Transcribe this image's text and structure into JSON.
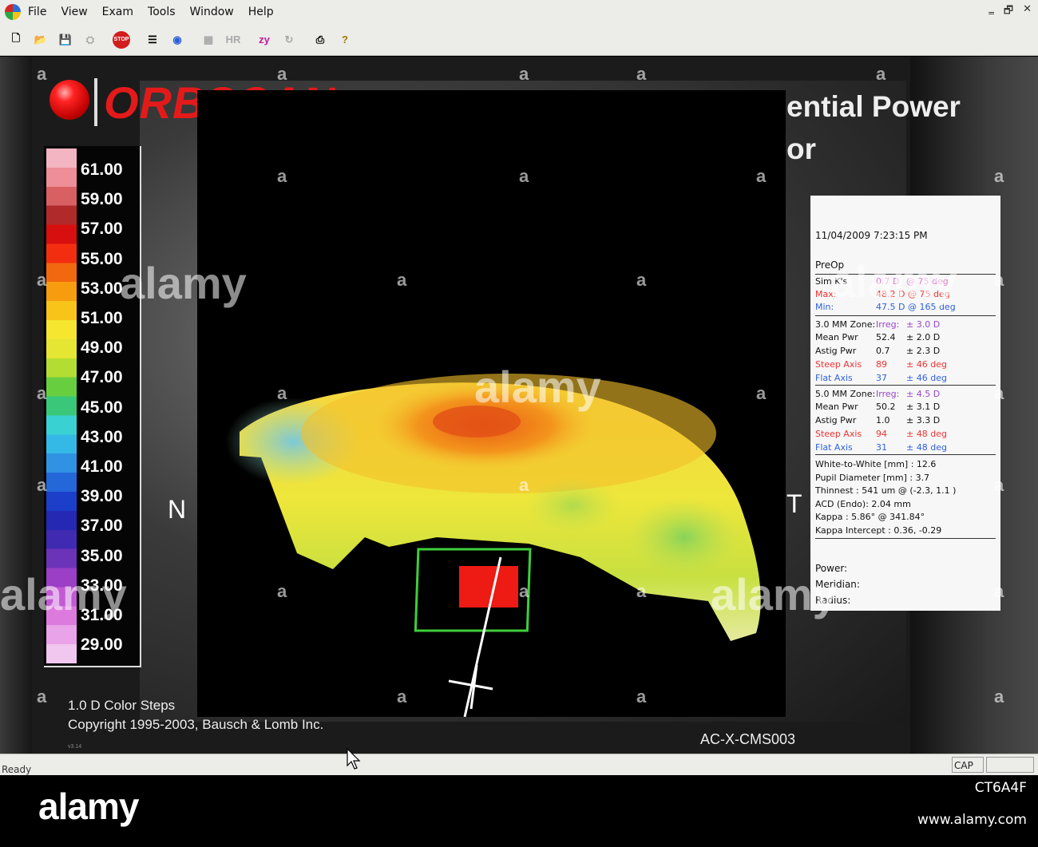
{
  "menu": {
    "items": [
      "File",
      "View",
      "Exam",
      "Tools",
      "Window",
      "Help"
    ],
    "window_controls": [
      "‗",
      "🗗",
      "✕"
    ]
  },
  "toolbar": {
    "buttons": [
      {
        "icon": "new-file-icon",
        "glyph": "🗋"
      },
      {
        "icon": "open-folder-icon",
        "glyph": "📂"
      },
      {
        "icon": "save-icon",
        "glyph": "💾"
      },
      {
        "icon": "disk-icon",
        "glyph": "⛭"
      },
      {
        "icon": "stop-icon",
        "label": "STOP"
      },
      {
        "icon": "list-icon",
        "glyph": "☰"
      },
      {
        "icon": "eye-icon",
        "glyph": "◉"
      },
      {
        "icon": "panel-icon",
        "glyph": "▦"
      },
      {
        "icon": "hr-icon",
        "label": "HR"
      },
      {
        "icon": "zy-icon",
        "label": "zy"
      },
      {
        "icon": "refresh-icon",
        "glyph": "↻"
      },
      {
        "icon": "print-icon",
        "glyph": "⎙"
      },
      {
        "icon": "help-icon",
        "glyph": "?"
      }
    ]
  },
  "header": {
    "logo_text": "ORBSCAN",
    "title_line1": "ential Power",
    "title_line2": "or"
  },
  "scale": {
    "labels": [
      "61.00",
      "59.00",
      "57.00",
      "55.00",
      "53.00",
      "51.00",
      "49.00",
      "47.00",
      "45.00",
      "43.00",
      "41.00",
      "39.00",
      "37.00",
      "35.00",
      "33.00",
      "31.00",
      "29.00"
    ],
    "colors": [
      "#f3b5c2",
      "#ee8e98",
      "#d86062",
      "#b02a2a",
      "#d80f0f",
      "#f32e10",
      "#f2680e",
      "#f89c0f",
      "#f8c419",
      "#f6e630",
      "#e5e533",
      "#b4dd33",
      "#67cf3f",
      "#39c77a",
      "#3ad1d3",
      "#34b9e6",
      "#2f92e3",
      "#2467d8",
      "#1b3fc9",
      "#2528b3",
      "#3f2ab1",
      "#6b33b8",
      "#9a3fc6",
      "#c35ad4",
      "#dc7bdd",
      "#e9a3e8",
      "#f1c6ef"
    ],
    "steps_label": "1.0 D Color Steps"
  },
  "footer_text": {
    "copyright": "Copyright 1995-2003, Bausch & Lomb Inc.",
    "version": "v3.14",
    "device_id": "AC-X-CMS003"
  },
  "map": {
    "side_left": "N",
    "side_right": "T"
  },
  "info": {
    "datetime": "11/04/2009 7:23:15 PM",
    "preop": "PreOp",
    "simk": {
      "label": "Sim K's",
      "a": "0.7 D",
      "b": "@ 75 deg"
    },
    "max": {
      "label": "Max:",
      "a": "48.2 D @ 75 deg"
    },
    "min": {
      "label": "Min:",
      "a": "47.5 D @ 165 deg"
    },
    "zone3": {
      "title": "3.0 MM Zone:",
      "irreg_label": "Irreg:",
      "irreg": "± 3.0 D",
      "rows": [
        {
          "k": "Mean Pwr",
          "v": "52.4",
          "e": "± 2.0 D",
          "cls": ""
        },
        {
          "k": "Astig Pwr",
          "v": "0.7",
          "e": "± 2.3 D",
          "cls": ""
        },
        {
          "k": "Steep Axis",
          "v": "89",
          "e": "± 46 deg",
          "cls": "red"
        },
        {
          "k": "Flat Axis",
          "v": "37",
          "e": "± 46 deg",
          "cls": "blue"
        }
      ]
    },
    "zone5": {
      "title": "5.0 MM Zone:",
      "irreg_label": "Irreg:",
      "irreg": "± 4.5 D",
      "rows": [
        {
          "k": "Mean Pwr",
          "v": "50.2",
          "e": "± 3.1 D",
          "cls": ""
        },
        {
          "k": "Astig Pwr",
          "v": "1.0",
          "e": "± 3.3 D",
          "cls": ""
        },
        {
          "k": "Steep Axis",
          "v": "94",
          "e": "± 48 deg",
          "cls": "red"
        },
        {
          "k": "Flat Axis",
          "v": "31",
          "e": "± 48 deg",
          "cls": "blue"
        }
      ]
    },
    "measurements": [
      "White-to-White [mm] : 12.6",
      "Pupil Diameter [mm] : 3.7",
      "Thinnest : 541 um @ (-2.3, 1.1 )",
      "ACD (Endo): 2.04 mm",
      "Kappa : 5.86° @ 341.84°",
      "Kappa Intercept : 0.36, -0.29"
    ],
    "cursor_labels": [
      "Power:",
      "Meridian:",
      "Radius:"
    ]
  },
  "status": {
    "text": "Ready",
    "cap": "CAP"
  },
  "watermark": {
    "brand": "alamy",
    "image_id": "CT6A4F",
    "url": "www.alamy.com"
  }
}
